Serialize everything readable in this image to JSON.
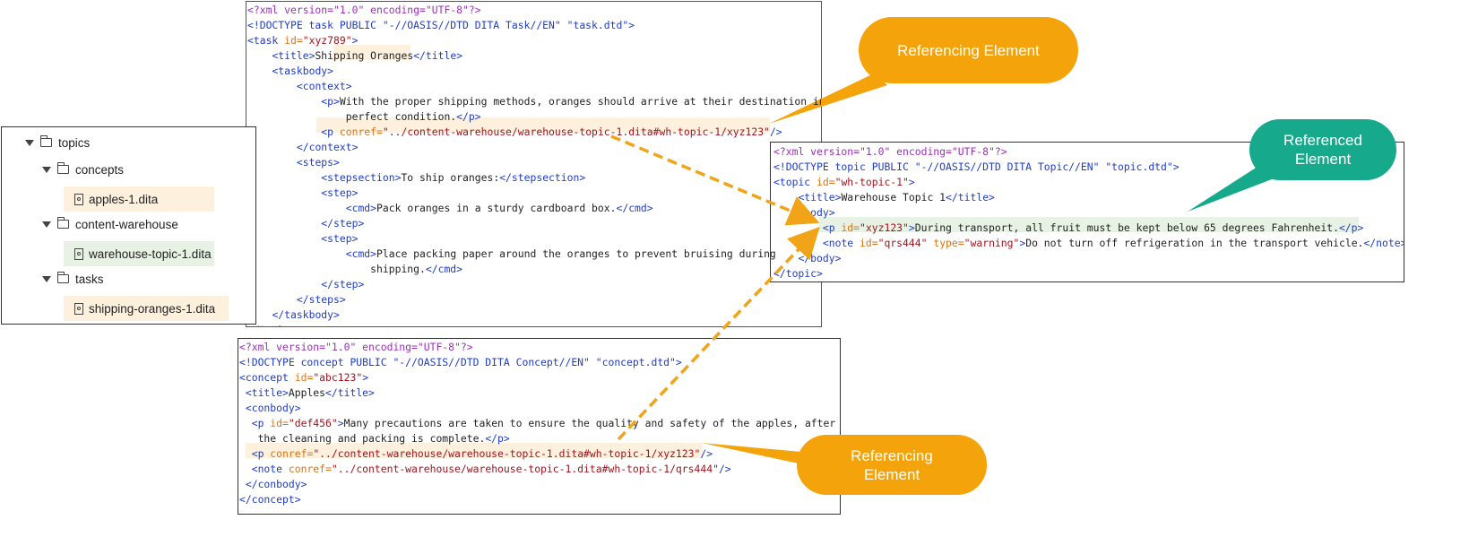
{
  "tree": {
    "root": "topics",
    "folders": [
      {
        "label": "concepts",
        "file": "apples-1.dita"
      },
      {
        "label": "content-warehouse",
        "file": "warehouse-topic-1.dita"
      },
      {
        "label": "tasks",
        "file": "shipping-oranges-1.dita"
      }
    ]
  },
  "task_xml": {
    "lines": [
      [
        [
          "pi",
          "<?xml version=\"1.0\" encoding=\"UTF-8\"?>"
        ]
      ],
      [
        [
          "dt",
          "<!DOCTYPE task PUBLIC \"-//OASIS//DTD DITA Task//EN\" \"task.dtd\">"
        ]
      ],
      [
        [
          "tg",
          "<task "
        ],
        [
          "an",
          "id="
        ],
        [
          "av",
          "\"xyz789\""
        ],
        [
          "tg",
          ">"
        ]
      ],
      [
        [
          "tx",
          "    "
        ],
        [
          "tg",
          "<title>"
        ],
        [
          "tx",
          "Shipping Oranges"
        ],
        [
          "tg",
          "</title>"
        ]
      ],
      [
        [
          "tx",
          "    "
        ],
        [
          "tg",
          "<taskbody>"
        ]
      ],
      [
        [
          "tx",
          "        "
        ],
        [
          "tg",
          "<context>"
        ]
      ],
      [
        [
          "tx",
          "            "
        ],
        [
          "tg",
          "<p>"
        ],
        [
          "tx",
          "With the proper shipping methods, oranges should arrive at their destination in"
        ]
      ],
      [
        [
          "tx",
          "                perfect condition."
        ],
        [
          "tg",
          "</p>"
        ]
      ],
      [
        [
          "tx",
          "            "
        ],
        [
          "tg",
          "<p "
        ],
        [
          "an",
          "conref="
        ],
        [
          "av",
          "\"../content-warehouse/warehouse-topic-1.dita#wh-topic-1/xyz123\""
        ],
        [
          "tg",
          "/>"
        ]
      ],
      [
        [
          "tx",
          "        "
        ],
        [
          "tg",
          "</context>"
        ]
      ],
      [
        [
          "tx",
          "        "
        ],
        [
          "tg",
          "<steps>"
        ]
      ],
      [
        [
          "tx",
          "            "
        ],
        [
          "tg",
          "<stepsection>"
        ],
        [
          "tx",
          "To ship oranges:"
        ],
        [
          "tg",
          "</stepsection>"
        ]
      ],
      [
        [
          "tx",
          "            "
        ],
        [
          "tg",
          "<step>"
        ]
      ],
      [
        [
          "tx",
          "                "
        ],
        [
          "tg",
          "<cmd>"
        ],
        [
          "tx",
          "Pack oranges in a sturdy cardboard box."
        ],
        [
          "tg",
          "</cmd>"
        ]
      ],
      [
        [
          "tx",
          "            "
        ],
        [
          "tg",
          "</step>"
        ]
      ],
      [
        [
          "tx",
          "            "
        ],
        [
          "tg",
          "<step>"
        ]
      ],
      [
        [
          "tx",
          "                "
        ],
        [
          "tg",
          "<cmd>"
        ],
        [
          "tx",
          "Place packing paper around the oranges to prevent bruising during"
        ]
      ],
      [
        [
          "tx",
          "                    shipping."
        ],
        [
          "tg",
          "</cmd>"
        ]
      ],
      [
        [
          "tx",
          "            "
        ],
        [
          "tg",
          "</step>"
        ]
      ],
      [
        [
          "tx",
          "        "
        ],
        [
          "tg",
          "</steps>"
        ]
      ],
      [
        [
          "tx",
          "    "
        ],
        [
          "tg",
          "</taskbody>"
        ]
      ],
      [
        [
          "tg",
          "</task>"
        ]
      ]
    ]
  },
  "topic_xml": {
    "lines": [
      [
        [
          "pi",
          "<?xml version=\"1.0\" encoding=\"UTF-8\"?>"
        ]
      ],
      [
        [
          "dt",
          "<!DOCTYPE topic PUBLIC \"-//OASIS//DTD DITA Topic//EN\" \"topic.dtd\">"
        ]
      ],
      [
        [
          "tg",
          "<topic "
        ],
        [
          "an",
          "id="
        ],
        [
          "av",
          "\"wh-topic-1\""
        ],
        [
          "tg",
          ">"
        ]
      ],
      [
        [
          "tx",
          "    "
        ],
        [
          "tg",
          "<title>"
        ],
        [
          "tx",
          "Warehouse Topic 1"
        ],
        [
          "tg",
          "</title>"
        ]
      ],
      [
        [
          "tx",
          "    "
        ],
        [
          "tg",
          "<body>"
        ]
      ],
      [
        [
          "tx",
          "        "
        ],
        [
          "tg",
          "<p "
        ],
        [
          "an",
          "id="
        ],
        [
          "av",
          "\"xyz123\""
        ],
        [
          "tg",
          ">"
        ],
        [
          "tx",
          "During transport, all fruit must be kept below 65 degrees Fahrenheit."
        ],
        [
          "tg",
          "</p>"
        ]
      ],
      [
        [
          "tx",
          "        "
        ],
        [
          "tg",
          "<note "
        ],
        [
          "an",
          "id="
        ],
        [
          "av",
          "\"qrs444\" "
        ],
        [
          "an",
          "type="
        ],
        [
          "av",
          "\"warning\""
        ],
        [
          "tg",
          ">"
        ],
        [
          "tx",
          "Do not turn off refrigeration in the transport vehicle."
        ],
        [
          "tg",
          "</note>"
        ]
      ],
      [
        [
          "tx",
          "    "
        ],
        [
          "tg",
          "</body>"
        ]
      ],
      [
        [
          "tg",
          "</topic>"
        ]
      ]
    ]
  },
  "concept_xml": {
    "lines": [
      [
        [
          "pi",
          "<?xml version=\"1.0\" encoding=\"UTF-8\"?>"
        ]
      ],
      [
        [
          "dt",
          "<!DOCTYPE concept PUBLIC \"-//OASIS//DTD DITA Concept//EN\" \"concept.dtd\">"
        ]
      ],
      [
        [
          "tg",
          "<concept "
        ],
        [
          "an",
          "id="
        ],
        [
          "av",
          "\"abc123\""
        ],
        [
          "tg",
          ">"
        ]
      ],
      [
        [
          "tx",
          " "
        ],
        [
          "tg",
          "<title>"
        ],
        [
          "tx",
          "Apples"
        ],
        [
          "tg",
          "</title>"
        ]
      ],
      [
        [
          "tx",
          " "
        ],
        [
          "tg",
          "<conbody>"
        ]
      ],
      [
        [
          "tx",
          "  "
        ],
        [
          "tg",
          "<p "
        ],
        [
          "an",
          "id="
        ],
        [
          "av",
          "\"def456\""
        ],
        [
          "tg",
          ">"
        ],
        [
          "tx",
          "Many precautions are taken to ensure the quality and safety of the apples, after"
        ]
      ],
      [
        [
          "tx",
          "   the cleaning and packing is complete."
        ],
        [
          "tg",
          "</p>"
        ]
      ],
      [
        [
          "tx",
          "  "
        ],
        [
          "tg",
          "<p "
        ],
        [
          "an",
          "conref="
        ],
        [
          "av",
          "\"../content-warehouse/warehouse-topic-1.dita#wh-topic-1/xyz123\""
        ],
        [
          "tg",
          "/>"
        ]
      ],
      [
        [
          "tx",
          "  "
        ],
        [
          "tg",
          "<note "
        ],
        [
          "an",
          "conref="
        ],
        [
          "av",
          "\"../content-warehouse/warehouse-topic-1.dita#wh-topic-1/qrs444\""
        ],
        [
          "tg",
          "/>"
        ]
      ],
      [
        [
          "tx",
          " "
        ],
        [
          "tg",
          "</conbody>"
        ]
      ],
      [
        [
          "tg",
          "</concept>"
        ]
      ]
    ]
  },
  "callouts": {
    "referencing_top": "Referencing Element",
    "referenced": "Referenced Element",
    "referencing_bottom": "Referencing Element"
  },
  "colors": {
    "callout_orange": "#f5a30b",
    "callout_teal": "#16a98c",
    "arrow_orange": "#f2a418",
    "highlight_orange": "#fdf1de",
    "highlight_green": "#e7f2e5"
  }
}
